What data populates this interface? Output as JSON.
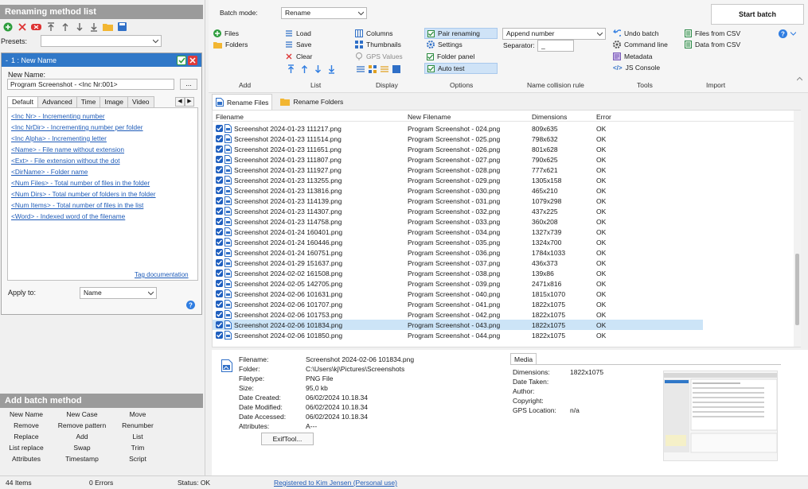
{
  "left": {
    "title": "Renaming method list",
    "presets_label": "Presets:",
    "presets_value": "",
    "method": {
      "name": "1 : New Name",
      "new_name_label": "New Name:",
      "new_name_value": "Program Screenshot - <Inc Nr:001>",
      "browse_label": "...",
      "tabs": [
        "Default",
        "Advanced",
        "Time",
        "Image",
        "Video"
      ],
      "tags": [
        "<Inc Nr> - Incrementing number",
        "<Inc NrDir> - Incrementing number per folder",
        "<Inc Alpha> - Incrementing letter",
        "<Name> - File name without extension",
        "<Ext> - File extension without the dot",
        "<DirName> - Folder name",
        "<Num Files> - Total number of files in the folder",
        "<Num Dirs> - Total number of folders in the folder",
        "<Num Items> - Total number of files in the list",
        "<Word> - Indexed word of the filename"
      ],
      "tag_doc": "Tag documentation",
      "apply_label": "Apply to:",
      "apply_value": "Name"
    },
    "add_title": "Add batch method",
    "add_items": [
      [
        "New Name",
        "New Case",
        "Move"
      ],
      [
        "Remove",
        "Remove pattern",
        "Renumber"
      ],
      [
        "Replace",
        "Add",
        "List"
      ],
      [
        "List replace",
        "Swap",
        "Trim"
      ],
      [
        "Attributes",
        "Timestamp",
        "Script"
      ]
    ]
  },
  "ribbon": {
    "batch_mode_label": "Batch mode:",
    "batch_mode_value": "Rename",
    "start_batch": "Start batch",
    "add": {
      "files": "Files",
      "folders": "Folders",
      "label": "Add"
    },
    "list": {
      "load": "Load",
      "save": "Save",
      "clear": "Clear",
      "label": "List"
    },
    "display": {
      "columns": "Columns",
      "thumbnails": "Thumbnails",
      "gps": "GPS Values",
      "label": "Display"
    },
    "options": {
      "pair": "Pair renaming",
      "settings": "Settings",
      "folder_panel": "Folder panel",
      "auto_test": "Auto test",
      "label": "Options"
    },
    "collision": {
      "value": "Append number",
      "separator_label": "Separator:",
      "separator_value": "_",
      "label": "Name collision rule"
    },
    "tools": {
      "undo": "Undo batch",
      "cmd": "Command line",
      "meta": "Metadata",
      "js": "JS Console",
      "label": "Tools"
    },
    "import": {
      "csv_files": "Files from CSV",
      "csv_data": "Data from CSV",
      "label": "Import"
    }
  },
  "list": {
    "tabs": [
      "Rename Files",
      "Rename Folders"
    ],
    "columns": [
      "Filename",
      "New Filename",
      "Dimensions",
      "Error"
    ],
    "rows": [
      [
        "Screenshot 2024-01-23 111217.png",
        "Program Screenshot - 024.png",
        "809x635",
        "OK"
      ],
      [
        "Screenshot 2024-01-23 111514.png",
        "Program Screenshot - 025.png",
        "798x632",
        "OK"
      ],
      [
        "Screenshot 2024-01-23 111651.png",
        "Program Screenshot - 026.png",
        "801x628",
        "OK"
      ],
      [
        "Screenshot 2024-01-23 111807.png",
        "Program Screenshot - 027.png",
        "790x625",
        "OK"
      ],
      [
        "Screenshot 2024-01-23 111927.png",
        "Program Screenshot - 028.png",
        "777x621",
        "OK"
      ],
      [
        "Screenshot 2024-01-23 113255.png",
        "Program Screenshot - 029.png",
        "1305x158",
        "OK"
      ],
      [
        "Screenshot 2024-01-23 113816.png",
        "Program Screenshot - 030.png",
        "465x210",
        "OK"
      ],
      [
        "Screenshot 2024-01-23 114139.png",
        "Program Screenshot - 031.png",
        "1079x298",
        "OK"
      ],
      [
        "Screenshot 2024-01-23 114307.png",
        "Program Screenshot - 032.png",
        "437x225",
        "OK"
      ],
      [
        "Screenshot 2024-01-23 114758.png",
        "Program Screenshot - 033.png",
        "360x208",
        "OK"
      ],
      [
        "Screenshot 2024-01-24 160401.png",
        "Program Screenshot - 034.png",
        "1327x739",
        "OK"
      ],
      [
        "Screenshot 2024-01-24 160446.png",
        "Program Screenshot - 035.png",
        "1324x700",
        "OK"
      ],
      [
        "Screenshot 2024-01-24 160751.png",
        "Program Screenshot - 036.png",
        "1784x1033",
        "OK"
      ],
      [
        "Screenshot 2024-01-29 151637.png",
        "Program Screenshot - 037.png",
        "436x373",
        "OK"
      ],
      [
        "Screenshot 2024-02-02 161508.png",
        "Program Screenshot - 038.png",
        "139x86",
        "OK"
      ],
      [
        "Screenshot 2024-02-05 142705.png",
        "Program Screenshot - 039.png",
        "2471x816",
        "OK"
      ],
      [
        "Screenshot 2024-02-06 101631.png",
        "Program Screenshot - 040.png",
        "1815x1070",
        "OK"
      ],
      [
        "Screenshot 2024-02-06 101707.png",
        "Program Screenshot - 041.png",
        "1822x1075",
        "OK"
      ],
      [
        "Screenshot 2024-02-06 101753.png",
        "Program Screenshot - 042.png",
        "1822x1075",
        "OK"
      ],
      [
        "Screenshot 2024-02-06 101834.png",
        "Program Screenshot - 043.png",
        "1822x1075",
        "OK"
      ],
      [
        "Screenshot 2024-02-06 101850.png",
        "Program Screenshot - 044.png",
        "1822x1075",
        "OK"
      ]
    ]
  },
  "details": {
    "labels": [
      "Filename:",
      "Folder:",
      "Filetype:",
      "Size:",
      "Date Created:",
      "Date Modified:",
      "Date Accessed:",
      "Attributes:"
    ],
    "values": [
      "Screenshot 2024-02-06 101834.png",
      "C:\\Users\\kj\\Pictures\\Screenshots",
      "PNG File",
      "95,0 kb",
      "06/02/2024 10.18.34",
      "06/02/2024 10.18.34",
      "06/02/2024 10.18.34",
      "A---"
    ],
    "exif_button": "ExifTool...",
    "media_tab": "Media",
    "media_labels": [
      "Dimensions:",
      "Date Taken:",
      "Author:",
      "Copyright:",
      "GPS Location:"
    ],
    "media_values": [
      "1822x1075",
      "",
      "",
      "",
      "n/a"
    ]
  },
  "status": {
    "items": "44 Items",
    "errors": "0 Errors",
    "status": "Status: OK",
    "registered": "Registered to Kim Jensen (Personal use)"
  },
  "colors": {
    "accent": "#3078c8",
    "selected_row": "#cce4f7",
    "link": "#1e5bb8",
    "header_grey": "#9b9b9b"
  }
}
